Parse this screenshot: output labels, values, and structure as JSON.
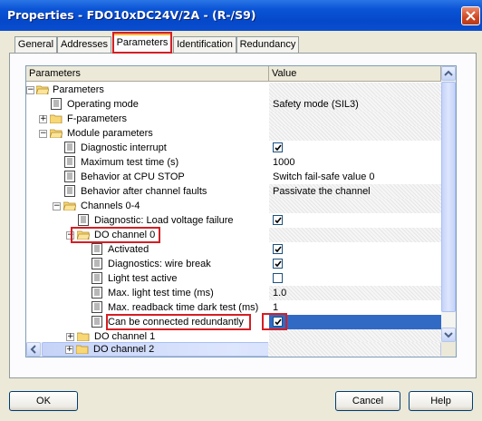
{
  "window": {
    "title": "Properties - FDO10xDC24V/2A - (R-/S9)"
  },
  "tabs": [
    {
      "label": "General"
    },
    {
      "label": "Addresses"
    },
    {
      "label": "Parameters"
    },
    {
      "label": "Identification"
    },
    {
      "label": "Redundancy"
    }
  ],
  "grid": {
    "col_parameters": "Parameters",
    "col_value": "Value"
  },
  "rows": [
    {
      "label": "Parameters",
      "value": ""
    },
    {
      "label": "Operating mode",
      "value": "Safety mode (SIL3)"
    },
    {
      "label": "F-parameters",
      "value": ""
    },
    {
      "label": "Module parameters",
      "value": ""
    },
    {
      "label": "Diagnostic interrupt",
      "value": "checked"
    },
    {
      "label": "Maximum test time (s)",
      "value": "1000"
    },
    {
      "label": "Behavior at CPU STOP",
      "value": "Switch fail-safe value 0"
    },
    {
      "label": "Behavior after channel faults",
      "value": "Passivate the channel"
    },
    {
      "label": "Channels 0-4",
      "value": ""
    },
    {
      "label": "Diagnostic: Load voltage failure",
      "value": "checked"
    },
    {
      "label": "DO channel 0",
      "value": ""
    },
    {
      "label": "Activated",
      "value": "checked"
    },
    {
      "label": "Diagnostics: wire break",
      "value": "checked"
    },
    {
      "label": "Light test active",
      "value": "unchecked"
    },
    {
      "label": "Max. light test time (ms)",
      "value": "1.0"
    },
    {
      "label": "Max. readback time dark test (ms)",
      "value": "1"
    },
    {
      "label": "Can be connected redundantly",
      "value": "checked"
    },
    {
      "label": "DO channel 1",
      "value": ""
    },
    {
      "label": "DO channel 2",
      "value": ""
    }
  ],
  "buttons": {
    "ok": "OK",
    "cancel": "Cancel",
    "help": "Help"
  },
  "colors": {
    "selection": "#316ac5",
    "highlight_box": "#d41f24",
    "title_bar": "#0a54d6"
  }
}
